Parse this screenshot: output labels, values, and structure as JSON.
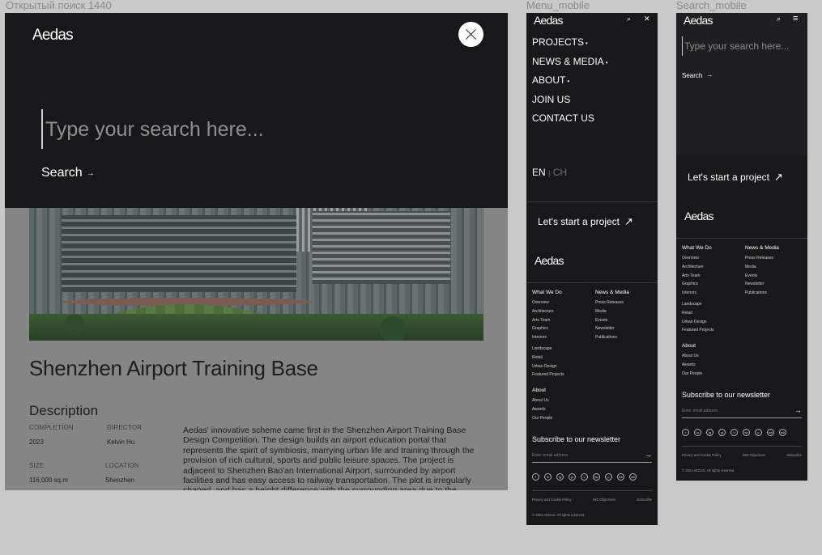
{
  "labels": {
    "desktop": "Открытый поиск 1440",
    "menu_mobile": "Menu_mobile",
    "search_mobile": "Search_mobile"
  },
  "brand": {
    "logo": "Aedas"
  },
  "search": {
    "placeholder": "Type your search here...",
    "button": "Search",
    "arrow": "→"
  },
  "project": {
    "title": "Shenzhen Airport Training Base",
    "description_heading": "Description",
    "meta": [
      {
        "key": "COMPLETION",
        "value": "2023"
      },
      {
        "key": "DIRECTOR",
        "value": "Kelvin Hu"
      },
      {
        "key": "SIZE",
        "value": "116,000 sq.m"
      },
      {
        "key": "LOCATION",
        "value": "Shenzhen"
      }
    ],
    "description": "Aedas' innovative scheme came first in the Shenzhen Airport Training Base Design Competition. The design builds an airport education portal that represents the spirit of symbiosis, marrying urban life and training through the provision of rich cultural, sports and public leisure spaces. The project is adjacent to Shenzhen Bao'an International Airport, surrounded by airport facilities and has easy access to railway transportation. The plot is irregularly shaped, and has a height difference with the surrounding area due to the"
  },
  "menu": {
    "items": [
      "PROJECTS",
      "NEWS & MEDIA",
      "ABOUT",
      "JOIN US",
      "CONTACT US"
    ],
    "dot": "•",
    "lang_en": "EN",
    "lang_sep": "|",
    "lang_ch": "CH"
  },
  "icons": {
    "search": "⌕",
    "close": "✕",
    "burger": "≡",
    "north_east": "↗"
  },
  "cta": "Let's start a project",
  "footer": {
    "what_we_do": {
      "heading": "What We Do",
      "items": [
        "Overview",
        "Architecture",
        "Arts Team",
        "Graphics",
        "Interiors",
        "Landscape",
        "Retail",
        "Urban Design",
        "Featured Projects"
      ]
    },
    "news_media": {
      "heading": "News & Media",
      "items": [
        "Press Releases",
        "Media",
        "Events",
        "Newsletter",
        "Publications"
      ]
    },
    "about": {
      "heading": "About",
      "items": [
        "About Us",
        "Awards",
        "Our People"
      ]
    },
    "newsletter": "Subscribe to our newsletter",
    "email_placeholder": "Enter email address",
    "socials": [
      "f",
      "in",
      "ig",
      "yt",
      "v",
      "tw",
      "p",
      "we",
      "wb"
    ],
    "legal": [
      "Privacy and Cookie Policy",
      "IMS Objectives",
      "Subscribe"
    ],
    "copyright": "© 2023 AEDAS. All rights reserved"
  }
}
